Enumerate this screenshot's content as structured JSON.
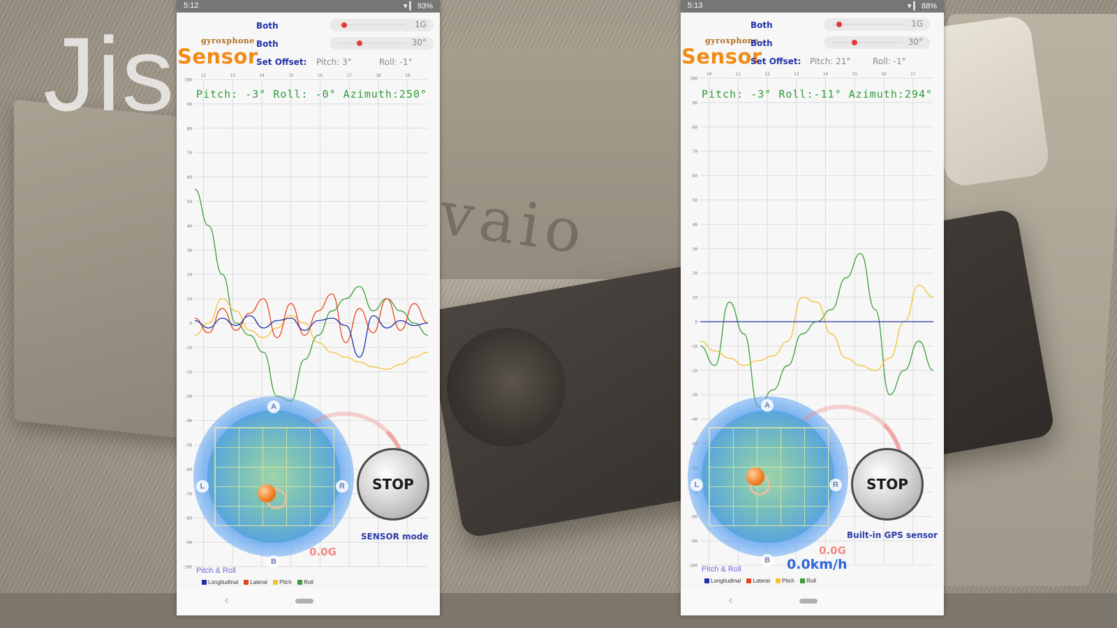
{
  "watermark": "Jis",
  "backdrop": {
    "brand_text": "vaio"
  },
  "left": {
    "status": {
      "time": "5:12",
      "right": "▾ ▎ 93%"
    },
    "logo": {
      "small": "gyroxphone",
      "big": "Sensor"
    },
    "controls": {
      "row1_label": "Both",
      "row1_value": "1G",
      "row2_label": "Both",
      "row2_value": "30°",
      "offset_label": "Set Offset:",
      "offset_pitch": "Pitch: 3°",
      "offset_roll": "Roll: -1°"
    },
    "readout": "Pitch: -3° Roll: -0° Azimuth:250°",
    "stop_label": "STOP",
    "mode_label": "SENSOR mode",
    "g_value": "0.0G",
    "pitch_roll_label": "Pitch & Roll",
    "joystick_letters": {
      "top": "A",
      "bottom": "B",
      "left": "L",
      "right": "R"
    },
    "legend": [
      "Longitudinal",
      "Lateral",
      "Pitch",
      "Roll"
    ]
  },
  "right": {
    "status": {
      "time": "5:13",
      "right": "▾ ▎ 88%"
    },
    "logo": {
      "small": "gyroxphone",
      "big": "Sensor"
    },
    "controls": {
      "row1_label": "Both",
      "row1_value": "1G",
      "row2_label": "Both",
      "row2_value": "30°",
      "offset_label": "Set Offset:",
      "offset_pitch": "Pitch: 21°",
      "offset_roll": "Roll: -1°"
    },
    "readout": "Pitch: -3° Roll:-11° Azimuth:294°",
    "stop_label": "STOP",
    "mode_label": "Built-in GPS sensor",
    "g_value": "0.0G",
    "speed": "0.0km/h",
    "pitch_roll_label": "Pitch & Roll",
    "joystick_letters": {
      "top": "A",
      "bottom": "B",
      "left": "L",
      "right": "R"
    },
    "legend": [
      "Longitudinal",
      "Lateral",
      "Pitch",
      "Roll"
    ]
  },
  "colors": {
    "longitudinal": "#1f2fa8",
    "lateral": "#e4471f",
    "pitch": "#f1c232",
    "roll": "#3a9c3a",
    "logo": "#f28b14",
    "readout": "#2e9a38"
  },
  "chart_data": [
    {
      "type": "line",
      "x_ticks": [
        "12",
        "13",
        "14",
        "15",
        "16",
        "17",
        "18",
        "19"
      ],
      "y_ticks": [
        "100",
        "90",
        "80",
        "70",
        "60",
        "50",
        "40",
        "30",
        "20",
        "10",
        "0",
        "-10",
        "-20",
        "-30",
        "-40",
        "-50",
        "-60",
        "-70",
        "-80",
        "-90",
        "-100"
      ],
      "ylim": [
        -100,
        100
      ],
      "series": [
        {
          "name": "Roll",
          "values": [
            55,
            40,
            20,
            0,
            -5,
            -12,
            -30,
            -32,
            -15,
            -5,
            5,
            10,
            15,
            5,
            10,
            5,
            0,
            -5
          ]
        },
        {
          "name": "Pitch",
          "values": [
            -5,
            0,
            10,
            5,
            -3,
            -6,
            -2,
            3,
            0,
            -8,
            -12,
            -14,
            -16,
            -18,
            -19,
            -17,
            -14,
            -12
          ]
        },
        {
          "name": "Lateral",
          "values": [
            2,
            -4,
            6,
            -3,
            4,
            10,
            -6,
            8,
            -5,
            5,
            12,
            -8,
            6,
            -4,
            10,
            -3,
            8,
            0
          ]
        },
        {
          "name": "Longitudinal",
          "values": [
            1,
            -2,
            2,
            -1,
            3,
            -2,
            1,
            2,
            -3,
            1,
            2,
            -1,
            -14,
            3,
            -2,
            1,
            -1,
            0
          ]
        }
      ]
    },
    {
      "type": "line",
      "x_ticks": [
        "10",
        "11",
        "12",
        "13",
        "14",
        "15",
        "16",
        "17"
      ],
      "y_ticks": [
        "100",
        "90",
        "80",
        "70",
        "60",
        "50",
        "40",
        "30",
        "20",
        "10",
        "0",
        "-10",
        "-20",
        "-30",
        "-40",
        "-50",
        "-60",
        "-70",
        "-80",
        "-90",
        "-100"
      ],
      "ylim": [
        -100,
        100
      ],
      "series": [
        {
          "name": "Roll",
          "values": [
            -10,
            -18,
            8,
            -5,
            -35,
            -28,
            -18,
            -5,
            0,
            5,
            18,
            28,
            5,
            -30,
            -20,
            -8,
            -20
          ]
        },
        {
          "name": "Pitch",
          "values": [
            -8,
            -12,
            -15,
            -18,
            -16,
            -14,
            -8,
            10,
            8,
            -5,
            -15,
            -18,
            -20,
            -15,
            0,
            15,
            10
          ]
        },
        {
          "name": "Longitudinal",
          "values": [
            0,
            0,
            0,
            0,
            0,
            0,
            0,
            0,
            0,
            0,
            0,
            0,
            0,
            0,
            0,
            0,
            0
          ]
        }
      ]
    }
  ]
}
